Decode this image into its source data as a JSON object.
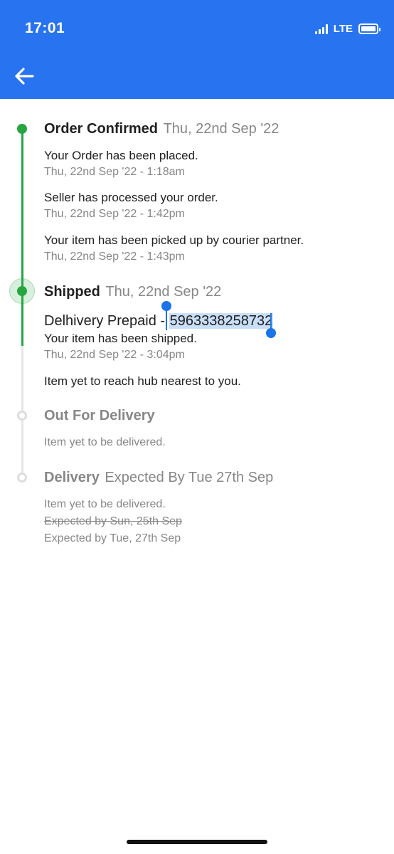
{
  "status_bar": {
    "time": "17:01",
    "network": "LTE"
  },
  "header": {
    "back_icon": "arrow-left-icon"
  },
  "timeline": {
    "confirmed": {
      "title": "Order Confirmed",
      "date": "Thu, 22nd Sep '22",
      "events": [
        {
          "text": "Your Order has been placed.",
          "time": "Thu, 22nd Sep '22 - 1:18am"
        },
        {
          "text": "Seller has processed your order.",
          "time": "Thu, 22nd Sep '22 - 1:42pm"
        },
        {
          "text": "Your item has been picked up by courier partner.",
          "time": "Thu, 22nd Sep '22 - 1:43pm"
        }
      ]
    },
    "shipped": {
      "title": "Shipped",
      "date": "Thu, 22nd Sep '22",
      "courier": "Delhivery Prepaid - ",
      "tracking_id": "5963338258732",
      "event_text": "Your item has been shipped.",
      "event_time": "Thu, 22nd Sep '22 - 3:04pm",
      "hub_note": "Item yet to reach hub nearest to you."
    },
    "out_for_delivery": {
      "title": "Out For Delivery",
      "note": "Item yet to be delivered."
    },
    "delivery": {
      "title": "Delivery",
      "date": "Expected By Tue 27th Sep",
      "note": "Item yet to be delivered.",
      "old_expected": "Expected by Sun, 25th Sep",
      "new_expected": "Expected by Tue, 27th Sep"
    }
  },
  "colors": {
    "header": "#2874f0",
    "progress": "#26a541",
    "pending": "#dedede",
    "selection": "#c9def7",
    "selection_handle": "#1a73e8"
  }
}
